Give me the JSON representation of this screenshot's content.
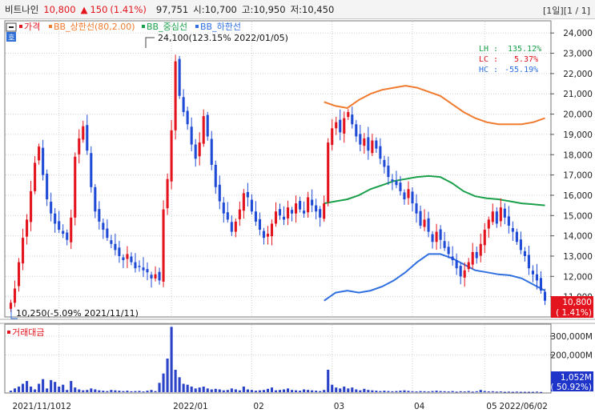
{
  "header": {
    "name": "비트나인",
    "price": "10,800",
    "change_arrow": "▲",
    "change": "150",
    "change_pct": "(1.41%)",
    "volume": "97,751",
    "open": "시:10,700",
    "high": "고:10,950",
    "low": "저:10,450",
    "period": "[1일][1 / 1]"
  },
  "legend": {
    "price": "가격",
    "bb_upper": "BB_상한선(80,2.00)",
    "bb_mid": "BB_중심선",
    "bb_lower": "BB_하한선",
    "volume": "거래대금"
  },
  "annotations": {
    "high": "24,100(123.15% 2022/01/05)",
    "low": "10,250(-5.09% 2021/11/11)"
  },
  "stats": {
    "lh_label": "LH :",
    "lh_value": "135.12%",
    "lc_label": "LC :",
    "lc_value": "5.37%",
    "hc_label": "HC :",
    "hc_value": "-55.19%"
  },
  "current_price_box": {
    "price": "10,800",
    "pct": "( 1.41%)"
  },
  "volume_box": {
    "value": "1,052M",
    "pct": "( 50.92%)"
  },
  "icons": {
    "window_menu": "close-square-icon",
    "chart_menu": "ho-badge-icon"
  },
  "colors": {
    "up": "#e3141d",
    "down": "#1f4bd6",
    "bb_upper": "#f07a2e",
    "bb_mid": "#1aa04a",
    "bb_lower": "#2f6fe0"
  },
  "chart_data": [
    {
      "type": "candlestick",
      "title": "비트나인",
      "x_ticks": [
        "2021/11/10",
        "12",
        "2022/01",
        "02",
        "03",
        "04",
        "05",
        "2022/06/02"
      ],
      "y_ticks": [
        "24,000",
        "23,000",
        "22,000",
        "21,000",
        "20,000",
        "19,000",
        "18,000",
        "17,000",
        "16,000",
        "15,000",
        "14,000",
        "13,000",
        "12,000",
        "11,000"
      ],
      "ylim": [
        10000,
        24600
      ],
      "close_sequence": [
        10700,
        11400,
        12700,
        13900,
        14800,
        16200,
        17600,
        18400,
        17000,
        15800,
        15100,
        14600,
        14300,
        14100,
        13800,
        14900,
        17900,
        18800,
        19400,
        18200,
        16400,
        15200,
        14700,
        14300,
        13900,
        13600,
        13300,
        13000,
        12800,
        13100,
        12700,
        12400,
        12500,
        12300,
        12200,
        11900,
        12100,
        11800,
        15300,
        16800,
        19200,
        22600,
        20900,
        20100,
        19500,
        18500,
        17800,
        18600,
        19900,
        18900,
        17500,
        16400,
        15700,
        15100,
        14800,
        14200,
        14700,
        15300,
        16100,
        15900,
        15200,
        14700,
        14300,
        13900,
        14100,
        14600,
        15200,
        15000,
        14800,
        15400,
        15100,
        15600,
        15300,
        15100,
        15900,
        15500,
        15200,
        14900,
        15600,
        18600,
        19300,
        19600,
        19100,
        19800,
        20100,
        19500,
        18900,
        18500,
        18800,
        18200,
        18700,
        18300,
        17800,
        17400,
        16900,
        16700,
        16500,
        16200,
        15800,
        16300,
        15600,
        15100,
        14500,
        14800,
        14200,
        13700,
        14200,
        13800,
        13400,
        13100,
        12800,
        12400,
        12000,
        12300,
        12700,
        13200,
        12900,
        13600,
        14300,
        14800,
        15200,
        14600,
        15400,
        14900,
        14500,
        14200,
        13700,
        13300,
        13000,
        12400,
        12100,
        11800,
        11300,
        10800
      ],
      "bb_upper": {
        "name": "BB_상한선(80,2.00)",
        "values": [
          20600,
          20400,
          20300,
          20700,
          21000,
          21200,
          21300,
          21400,
          21300,
          21100,
          20900,
          20500,
          20100,
          19800,
          19600,
          19500,
          19500,
          19500,
          19600,
          19800
        ]
      },
      "bb_mid": {
        "name": "BB_중심선",
        "values": [
          15600,
          15700,
          15800,
          16000,
          16300,
          16500,
          16700,
          16800,
          16900,
          16950,
          16900,
          16600,
          16200,
          15950,
          15850,
          15800,
          15700,
          15600,
          15550,
          15500
        ]
      },
      "bb_lower": {
        "name": "BB_하한선",
        "values": [
          10800,
          11200,
          11300,
          11200,
          11300,
          11500,
          11800,
          12200,
          12700,
          13100,
          13100,
          12900,
          12600,
          12300,
          12200,
          12100,
          12050,
          11900,
          11600,
          11300
        ]
      }
    },
    {
      "type": "bar",
      "title": "거래대금",
      "y_ticks": [
        "300,000M",
        "200,000M"
      ],
      "ylim": [
        0,
        360000
      ],
      "values": [
        8000,
        20000,
        30000,
        45000,
        60000,
        30000,
        15000,
        45000,
        70000,
        20000,
        65000,
        55000,
        30000,
        40000,
        12000,
        60000,
        25000,
        15000,
        10000,
        12000,
        20000,
        15000,
        10000,
        8000,
        6000,
        12000,
        10000,
        8000,
        6000,
        8000,
        5000,
        6000,
        7000,
        4000,
        8000,
        12000,
        6000,
        50000,
        100000,
        180000,
        350000,
        120000,
        80000,
        45000,
        40000,
        30000,
        20000,
        25000,
        30000,
        20000,
        15000,
        18000,
        15000,
        10000,
        12000,
        20000,
        15000,
        10000,
        30000,
        15000,
        12000,
        8000,
        10000,
        12000,
        18000,
        25000,
        10000,
        12000,
        15000,
        20000,
        12000,
        10000,
        8000,
        15000,
        12000,
        10000,
        8000,
        6000,
        12000,
        120000,
        40000,
        25000,
        20000,
        30000,
        20000,
        25000,
        15000,
        10000,
        18000,
        12000,
        10000,
        8000,
        6000,
        8000,
        6000,
        5000,
        6000,
        8000,
        10000,
        7000,
        5000,
        4000,
        6000,
        5000,
        4000,
        6000,
        8000,
        6000,
        5000,
        4000,
        6000,
        3000,
        5000,
        4000,
        6000,
        3000,
        5000,
        12000,
        6000,
        4000,
        5000,
        3000,
        4000,
        2000,
        3000,
        2000,
        3000,
        2000,
        2000,
        2000,
        2000,
        3000,
        1052
      ]
    }
  ]
}
